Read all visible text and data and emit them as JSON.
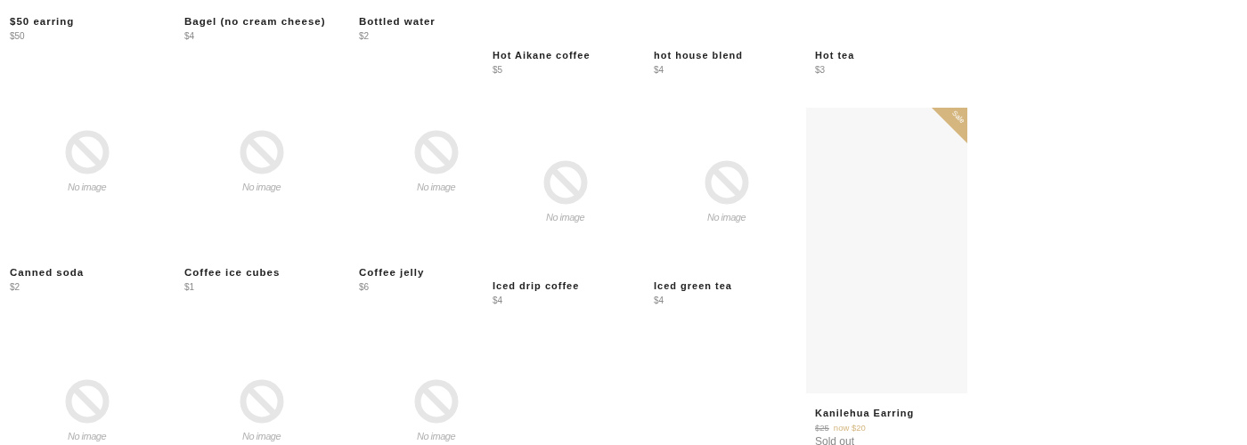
{
  "left_grid": {
    "items": [
      {
        "title": "$50 earring",
        "price": "$50"
      },
      {
        "title": "Bagel (no cream cheese)",
        "price": "$4"
      },
      {
        "title": "Bottled water",
        "price": "$2"
      },
      {
        "image_label": "No image",
        "title": "Canned soda",
        "price": "$2"
      },
      {
        "image_label": "No image",
        "title": "Coffee ice cubes",
        "price": "$1"
      },
      {
        "image_label": "No image",
        "title": "Coffee jelly",
        "price": "$6"
      },
      {
        "image_label": "No image"
      },
      {
        "image_label": "No image"
      },
      {
        "image_label": "No image"
      }
    ]
  },
  "right_grid": {
    "items": [
      {
        "title": "Hot Aikane coffee",
        "price": "$5"
      },
      {
        "title": "hot house blend",
        "price": "$4"
      },
      {
        "title": "Hot tea",
        "price": "$3"
      },
      {
        "image_label": "No image",
        "title": "Iced drip coffee",
        "price": "$4"
      },
      {
        "image_label": "No image",
        "title": "Iced green tea",
        "price": "$4"
      },
      {
        "badge": "Sale",
        "title": "Kanilehua Earring",
        "old_price": "$25",
        "sale_price": "now $20",
        "status": "Sold out"
      }
    ]
  }
}
